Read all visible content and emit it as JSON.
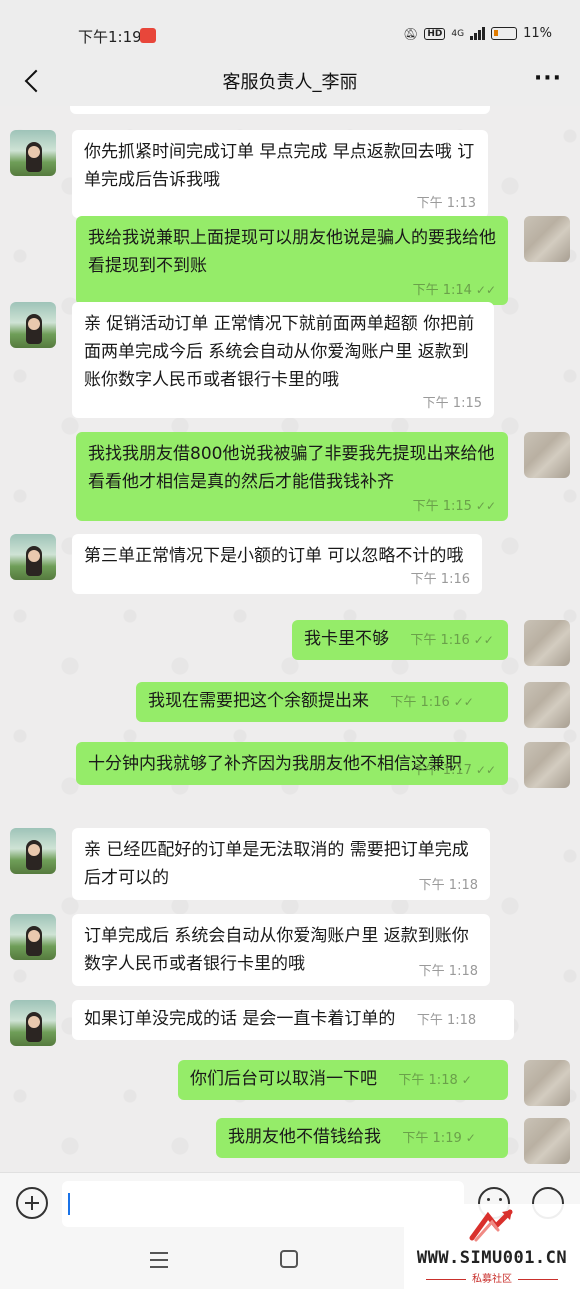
{
  "status_bar": {
    "time": "下午1:19",
    "network": "4G",
    "hd": "HD",
    "battery": "11%"
  },
  "header": {
    "title": "客服负责人_李丽"
  },
  "messages": [
    {
      "side": "left",
      "text": "你先抓紧时间完成订单 早点完成 早点返款回去哦 订单完成后告诉我哦",
      "time": "下午 1:13"
    },
    {
      "side": "right",
      "text": "我给我说兼职上面提现可以朋友他说是骗人的要我给他看提现到不到账",
      "time": "下午 1:14"
    },
    {
      "side": "left",
      "text": "亲 促销活动订单 正常情况下就前面两单超额 你把前面两单完成今后 系统会自动从你爱淘账户里 返款到账你数字人民币或者银行卡里的哦",
      "time": "下午 1:15"
    },
    {
      "side": "right",
      "text": "我找我朋友借800他说我被骗了非要我先提现出来给他看看他才相信是真的然后才能借我钱补齐",
      "time": "下午 1:15"
    },
    {
      "side": "left",
      "text": "第三单正常情况下是小额的订单 可以忽略不计的哦",
      "time": "下午 1:16"
    },
    {
      "side": "right",
      "text": "我卡里不够",
      "time": "下午 1:16"
    },
    {
      "side": "right",
      "text": "我现在需要把这个余额提出来",
      "time": "下午 1:16"
    },
    {
      "side": "right",
      "text": "十分钟内我就够了补齐因为我朋友他不相信这兼职",
      "time": "下午 1:17"
    },
    {
      "side": "left",
      "text": "亲 已经匹配好的订单是无法取消的 需要把订单完成后才可以的",
      "time": "下午 1:18"
    },
    {
      "side": "left",
      "text": "订单完成后 系统会自动从你爱淘账户里 返款到账你数字人民币或者银行卡里的哦",
      "time": "下午 1:18"
    },
    {
      "side": "left",
      "text": "如果订单没完成的话 是会一直卡着订单的",
      "time": "下午 1:18"
    },
    {
      "side": "right",
      "text": "你们后台可以取消一下吧",
      "time": "下午 1:18"
    },
    {
      "side": "right",
      "text": "我朋友他不借钱给我",
      "time": "下午 1:19"
    }
  ],
  "read_mark": "✓✓",
  "sent_mark": "✓",
  "watermark": {
    "site": "WWW.SIMU001.CN",
    "label": "私募社区"
  },
  "colors": {
    "bubble_right": "#95ec69",
    "bubble_left": "#ffffff",
    "background": "#ededed"
  }
}
